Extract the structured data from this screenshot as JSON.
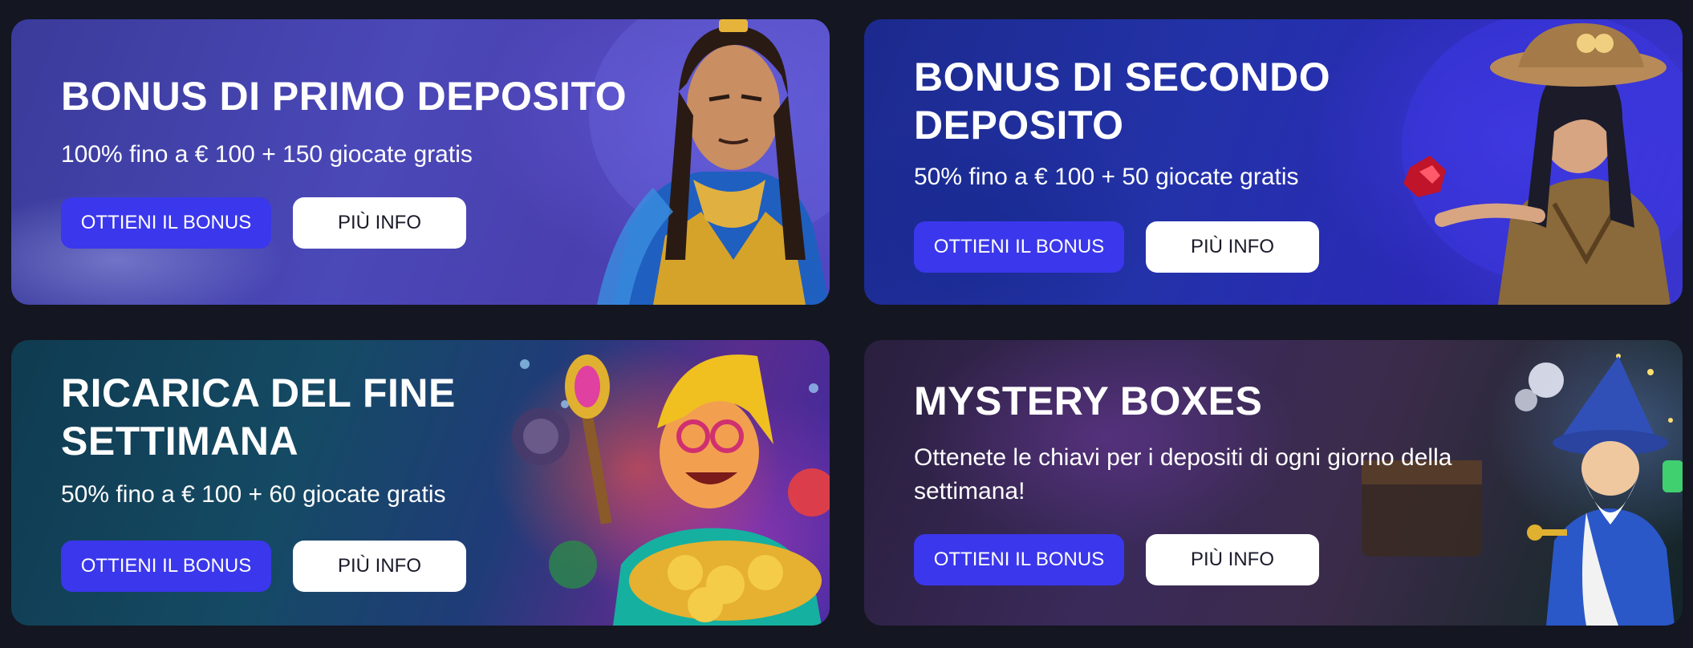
{
  "cards": [
    {
      "title": "BONUS DI PRIMO DEPOSITO",
      "subtitle": "100% fino a € 100 + 150 giocate gratis",
      "primary_label": "OTTIENI IL BONUS",
      "secondary_label": "PIÙ INFO"
    },
    {
      "title": "BONUS DI SECONDO\nDEPOSITO",
      "subtitle": "50% fino a € 100 + 50 giocate gratis",
      "primary_label": "OTTIENI IL BONUS",
      "secondary_label": "PIÙ INFO"
    },
    {
      "title": "RICARICA DEL FINE\nSETTIMANA",
      "subtitle": "50% fino a € 100 + 60 giocate gratis",
      "primary_label": "OTTIENI IL BONUS",
      "secondary_label": "PIÙ INFO"
    },
    {
      "title": "MYSTERY BOXES",
      "subtitle": "Ottenete le chiavi per i depositi di ogni giorno della settimana!",
      "primary_label": "OTTIENI IL BONUS",
      "secondary_label": "PIÙ INFO"
    }
  ],
  "icons": {
    "card1_art": "warrior-character-illustration",
    "card2_art": "explorer-character-illustration",
    "card3_art": "treasure-character-illustration",
    "card4_art": "wizard-character-illustration"
  },
  "colors": {
    "page_background": "#141621",
    "primary_button": "#3b37ec",
    "secondary_button": "#ffffff"
  }
}
